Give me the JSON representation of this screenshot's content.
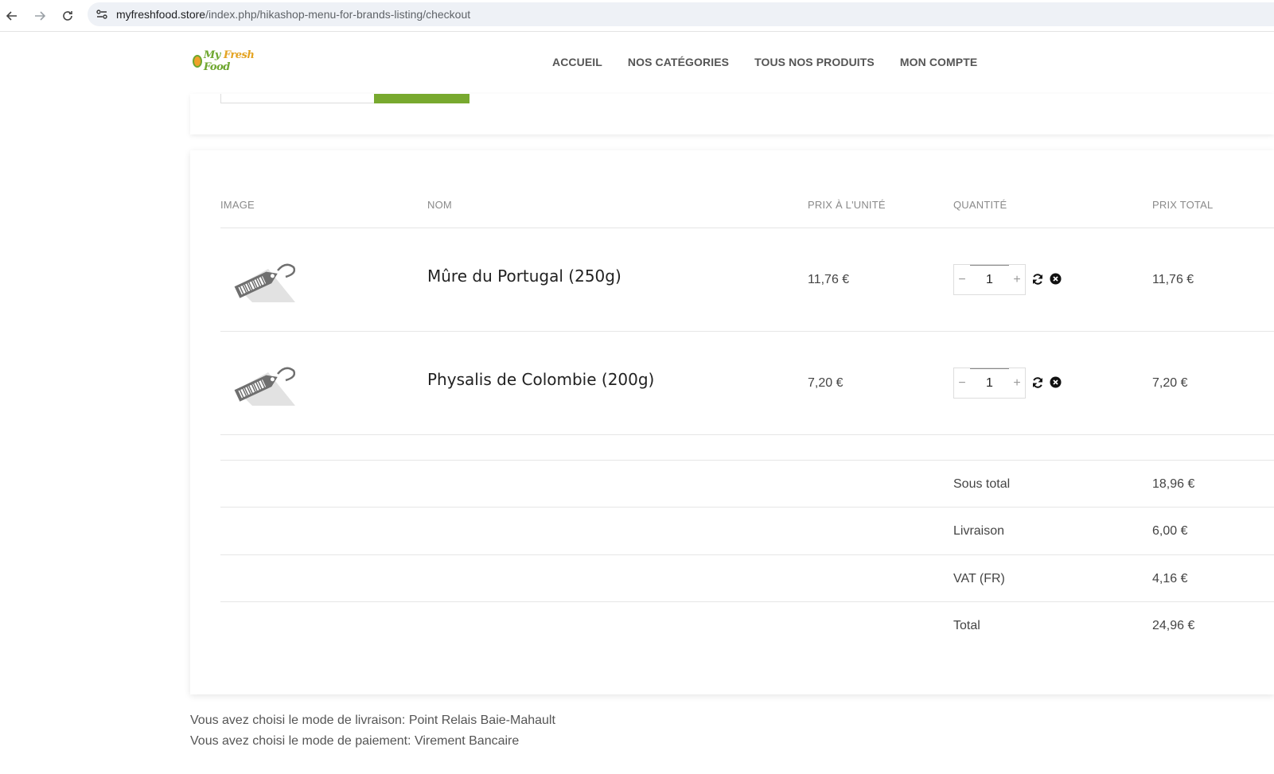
{
  "browser": {
    "url_domain": "myfreshfood.store",
    "url_path": "/index.php/hikashop-menu-for-brands-listing/checkout"
  },
  "header": {
    "logo": {
      "part1": "My",
      "part2": "Fresh",
      "part3": "Food"
    },
    "nav": [
      "ACCUEIL",
      "NOS CATÉGORIES",
      "TOUS NOS PRODUITS",
      "MON COMPTE"
    ]
  },
  "cart": {
    "columns": {
      "image": "IMAGE",
      "name": "NOM",
      "unit_price": "PRIX À L'UNITÉ",
      "quantity": "QUANTITÉ",
      "total_price": "PRIX TOTAL"
    },
    "items": [
      {
        "name": "Mûre du Portugal (250g)",
        "unit_price": "11,76 €",
        "quantity": "1",
        "total_price": "11,76 €",
        "icon": "price-tag-icon"
      },
      {
        "name": "Physalis de Colombie (200g)",
        "unit_price": "7,20 €",
        "quantity": "1",
        "total_price": "7,20 €",
        "icon": "price-tag-icon"
      }
    ],
    "summary": [
      {
        "label": "Sous total",
        "value": "18,96 €"
      },
      {
        "label": "Livraison",
        "value": "6,00 €"
      },
      {
        "label": "VAT (FR)",
        "value": "4,16 €"
      },
      {
        "label": "Total",
        "value": "24,96 €"
      }
    ],
    "qty_minus": "−",
    "qty_plus": "+"
  },
  "info": {
    "shipping": "Vous avez choisi le mode de livraison: Point Relais Baie-Mahault",
    "payment": "Vous avez choisi le mode de paiement: Virement Bancaire"
  },
  "colors": {
    "accent": "#78a92f",
    "text": "#444444",
    "muted": "#8a8a8a"
  }
}
